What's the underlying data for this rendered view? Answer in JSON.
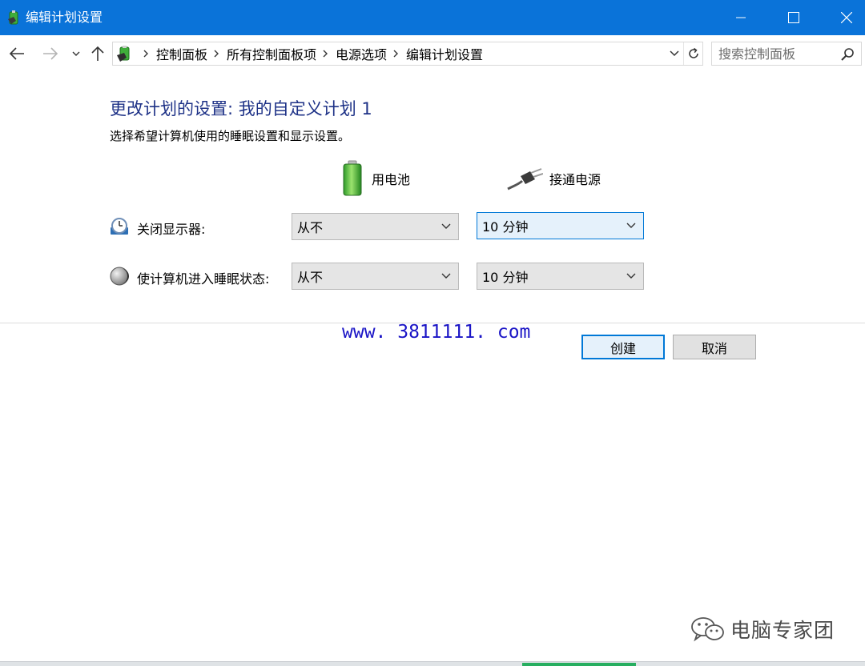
{
  "window": {
    "title": "编辑计划设置",
    "app_icon": "power-options-icon",
    "controls": [
      "minimize-icon",
      "maximize-icon",
      "close-icon"
    ]
  },
  "nav": {
    "back_icon": "arrow-left-icon",
    "forward_icon": "arrow-right-icon",
    "recent_icon": "chevron-down-icon",
    "up_icon": "arrow-up-icon"
  },
  "address": {
    "breadcrumbs": [
      "控制面板",
      "所有控制面板项",
      "电源选项",
      "编辑计划设置"
    ],
    "dropdown_icon": "chevron-down-icon",
    "refresh_icon": "refresh-icon"
  },
  "search": {
    "placeholder": "搜索控制面板",
    "icon": "search-icon"
  },
  "content": {
    "title": "更改计划的设置: 我的自定义计划 1",
    "subtitle": "选择希望计算机使用的睡眠设置和显示设置。",
    "columns": {
      "battery": {
        "label": "用电池",
        "icon": "battery-icon"
      },
      "plugged": {
        "label": "接通电源",
        "icon": "power-plug-icon"
      }
    },
    "rows": [
      {
        "label": "关闭显示器:",
        "icon": "display-clock-icon",
        "battery": "从不",
        "plugged": "10 分钟"
      },
      {
        "label": "使计算机进入睡眠状态:",
        "icon": "moon-icon",
        "battery": "从不",
        "plugged": "10 分钟"
      }
    ]
  },
  "watermark": {
    "url": "www. 3811111. com"
  },
  "buttons": {
    "create": "创建",
    "cancel": "取消"
  },
  "brand": {
    "text": "电脑专家团",
    "icon": "wechat-icon"
  },
  "colors": {
    "titlebar": "#0a73d9",
    "heading": "#1e3287",
    "focus": "#0078d7",
    "watermark": "#1a14c6"
  }
}
